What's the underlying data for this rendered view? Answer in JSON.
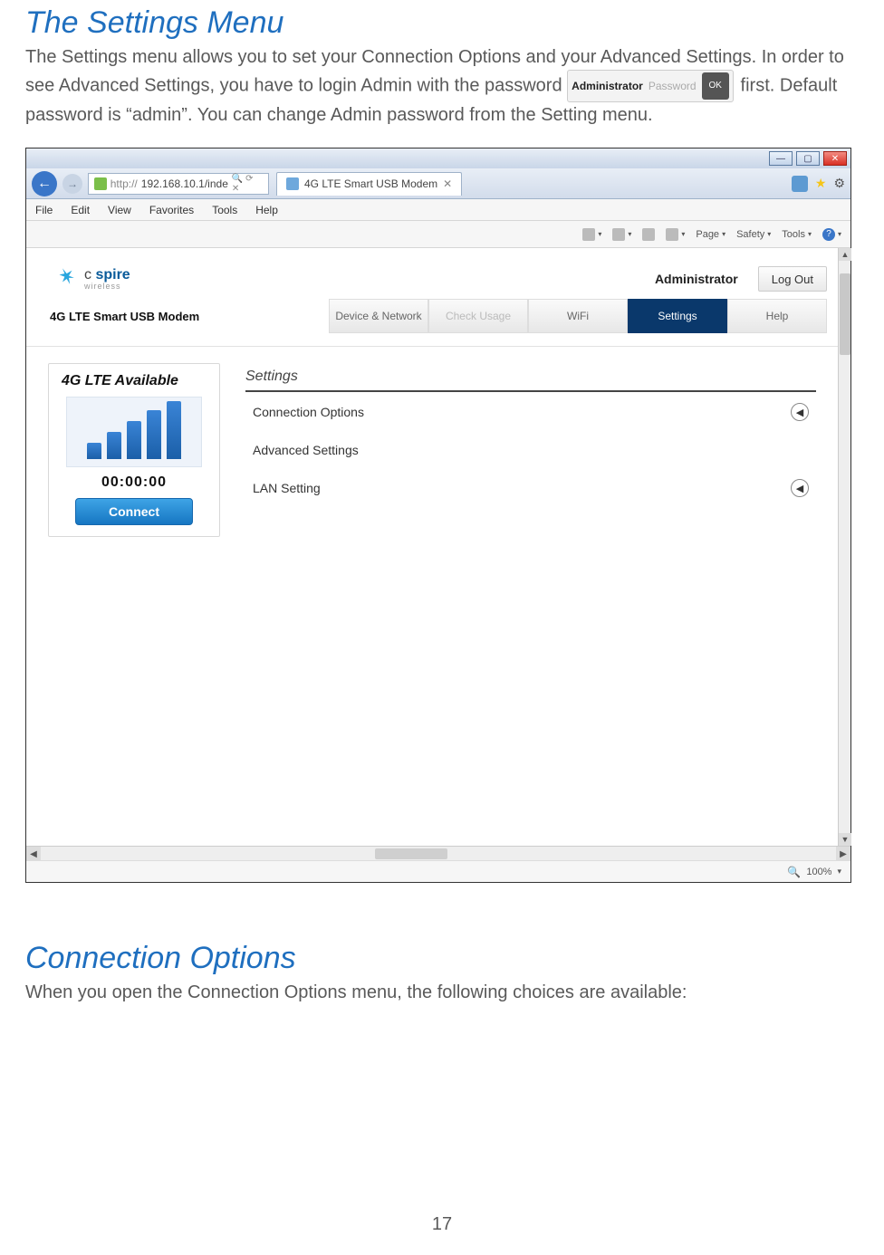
{
  "doc": {
    "heading1": "The Settings Menu",
    "para1a": "The Settings menu allows you to set your Connection Options and your Advanced Settings. In order to see Advanced Settings, you have to login Admin with the password ",
    "para1b": "first.  Default password is “admin”.  You can change Admin password from the Setting menu.",
    "heading2": "Connection Options",
    "para2": "When you open the Connection Options menu, the following choices are available:",
    "page_number": "17",
    "login_chip": {
      "label": "Administrator",
      "placeholder": "Password",
      "ok": "OK"
    }
  },
  "browser": {
    "url_prefix": "http://",
    "url": "192.168.10.1/inde",
    "url_suffix_icons": "🔍 ⟳ ✕",
    "tab_title": "4G LTE Smart USB Modem",
    "menus": [
      "File",
      "Edit",
      "View",
      "Favorites",
      "Tools",
      "Help"
    ],
    "cmdbar": {
      "page": "Page",
      "safety": "Safety",
      "tools": "Tools"
    },
    "zoom": "100%"
  },
  "app": {
    "brand_c": "c ",
    "brand_spire": "spire",
    "brand_sub": "wireless",
    "product": "4G LTE Smart USB Modem",
    "admin": "Administrator",
    "logout": "Log Out",
    "tabs": {
      "device": "Device & Network",
      "usage": "Check Usage",
      "wifi": "WiFi",
      "settings": "Settings",
      "help": "Help"
    },
    "side": {
      "title": "4G LTE Available",
      "counter": "00:00:00",
      "connect": "Connect"
    },
    "settings": {
      "title": "Settings",
      "items": [
        {
          "label": "Connection Options",
          "expand": true
        },
        {
          "label": "Advanced Settings",
          "expand": false
        },
        {
          "label": "LAN Setting",
          "expand": true
        }
      ]
    }
  }
}
